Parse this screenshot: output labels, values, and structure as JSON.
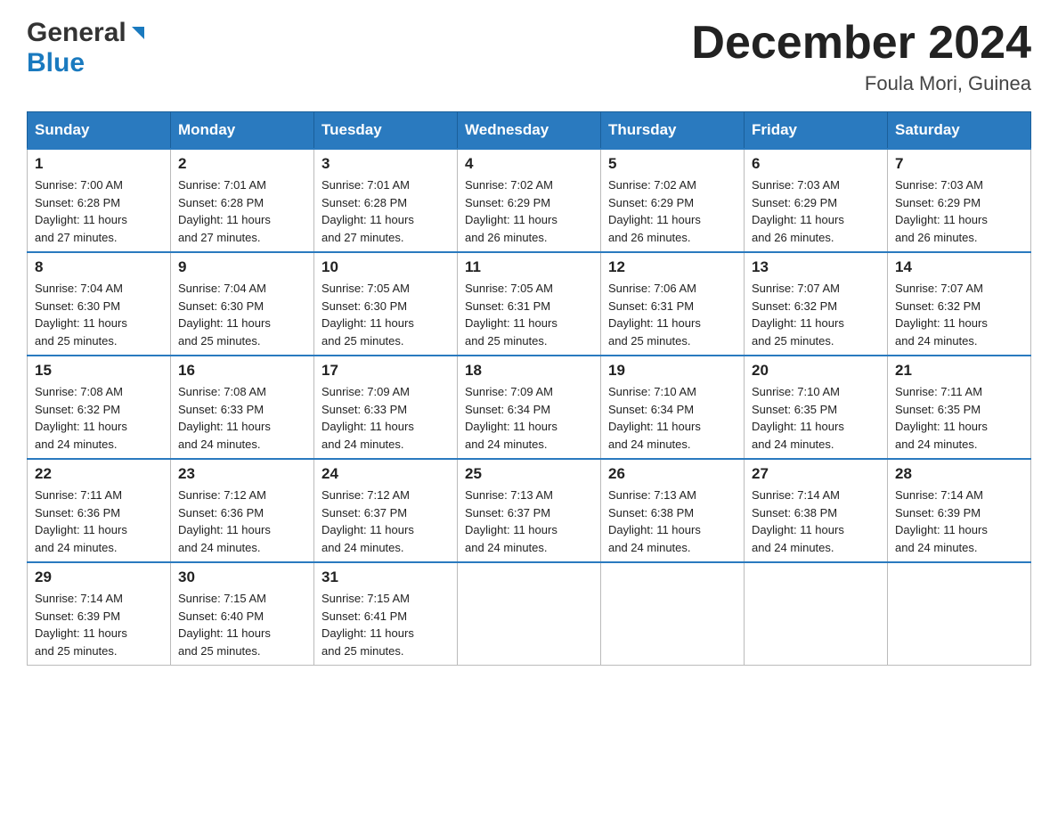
{
  "header": {
    "logo_general": "General",
    "logo_blue": "Blue",
    "month_title": "December 2024",
    "location": "Foula Mori, Guinea"
  },
  "days_of_week": [
    "Sunday",
    "Monday",
    "Tuesday",
    "Wednesday",
    "Thursday",
    "Friday",
    "Saturday"
  ],
  "weeks": [
    [
      {
        "day": "1",
        "sunrise": "7:00 AM",
        "sunset": "6:28 PM",
        "daylight": "11 hours and 27 minutes."
      },
      {
        "day": "2",
        "sunrise": "7:01 AM",
        "sunset": "6:28 PM",
        "daylight": "11 hours and 27 minutes."
      },
      {
        "day": "3",
        "sunrise": "7:01 AM",
        "sunset": "6:28 PM",
        "daylight": "11 hours and 27 minutes."
      },
      {
        "day": "4",
        "sunrise": "7:02 AM",
        "sunset": "6:29 PM",
        "daylight": "11 hours and 26 minutes."
      },
      {
        "day": "5",
        "sunrise": "7:02 AM",
        "sunset": "6:29 PM",
        "daylight": "11 hours and 26 minutes."
      },
      {
        "day": "6",
        "sunrise": "7:03 AM",
        "sunset": "6:29 PM",
        "daylight": "11 hours and 26 minutes."
      },
      {
        "day": "7",
        "sunrise": "7:03 AM",
        "sunset": "6:29 PM",
        "daylight": "11 hours and 26 minutes."
      }
    ],
    [
      {
        "day": "8",
        "sunrise": "7:04 AM",
        "sunset": "6:30 PM",
        "daylight": "11 hours and 25 minutes."
      },
      {
        "day": "9",
        "sunrise": "7:04 AM",
        "sunset": "6:30 PM",
        "daylight": "11 hours and 25 minutes."
      },
      {
        "day": "10",
        "sunrise": "7:05 AM",
        "sunset": "6:30 PM",
        "daylight": "11 hours and 25 minutes."
      },
      {
        "day": "11",
        "sunrise": "7:05 AM",
        "sunset": "6:31 PM",
        "daylight": "11 hours and 25 minutes."
      },
      {
        "day": "12",
        "sunrise": "7:06 AM",
        "sunset": "6:31 PM",
        "daylight": "11 hours and 25 minutes."
      },
      {
        "day": "13",
        "sunrise": "7:07 AM",
        "sunset": "6:32 PM",
        "daylight": "11 hours and 25 minutes."
      },
      {
        "day": "14",
        "sunrise": "7:07 AM",
        "sunset": "6:32 PM",
        "daylight": "11 hours and 24 minutes."
      }
    ],
    [
      {
        "day": "15",
        "sunrise": "7:08 AM",
        "sunset": "6:32 PM",
        "daylight": "11 hours and 24 minutes."
      },
      {
        "day": "16",
        "sunrise": "7:08 AM",
        "sunset": "6:33 PM",
        "daylight": "11 hours and 24 minutes."
      },
      {
        "day": "17",
        "sunrise": "7:09 AM",
        "sunset": "6:33 PM",
        "daylight": "11 hours and 24 minutes."
      },
      {
        "day": "18",
        "sunrise": "7:09 AM",
        "sunset": "6:34 PM",
        "daylight": "11 hours and 24 minutes."
      },
      {
        "day": "19",
        "sunrise": "7:10 AM",
        "sunset": "6:34 PM",
        "daylight": "11 hours and 24 minutes."
      },
      {
        "day": "20",
        "sunrise": "7:10 AM",
        "sunset": "6:35 PM",
        "daylight": "11 hours and 24 minutes."
      },
      {
        "day": "21",
        "sunrise": "7:11 AM",
        "sunset": "6:35 PM",
        "daylight": "11 hours and 24 minutes."
      }
    ],
    [
      {
        "day": "22",
        "sunrise": "7:11 AM",
        "sunset": "6:36 PM",
        "daylight": "11 hours and 24 minutes."
      },
      {
        "day": "23",
        "sunrise": "7:12 AM",
        "sunset": "6:36 PM",
        "daylight": "11 hours and 24 minutes."
      },
      {
        "day": "24",
        "sunrise": "7:12 AM",
        "sunset": "6:37 PM",
        "daylight": "11 hours and 24 minutes."
      },
      {
        "day": "25",
        "sunrise": "7:13 AM",
        "sunset": "6:37 PM",
        "daylight": "11 hours and 24 minutes."
      },
      {
        "day": "26",
        "sunrise": "7:13 AM",
        "sunset": "6:38 PM",
        "daylight": "11 hours and 24 minutes."
      },
      {
        "day": "27",
        "sunrise": "7:14 AM",
        "sunset": "6:38 PM",
        "daylight": "11 hours and 24 minutes."
      },
      {
        "day": "28",
        "sunrise": "7:14 AM",
        "sunset": "6:39 PM",
        "daylight": "11 hours and 24 minutes."
      }
    ],
    [
      {
        "day": "29",
        "sunrise": "7:14 AM",
        "sunset": "6:39 PM",
        "daylight": "11 hours and 25 minutes."
      },
      {
        "day": "30",
        "sunrise": "7:15 AM",
        "sunset": "6:40 PM",
        "daylight": "11 hours and 25 minutes."
      },
      {
        "day": "31",
        "sunrise": "7:15 AM",
        "sunset": "6:41 PM",
        "daylight": "11 hours and 25 minutes."
      },
      null,
      null,
      null,
      null
    ]
  ],
  "labels": {
    "sunrise": "Sunrise:",
    "sunset": "Sunset:",
    "daylight": "Daylight:"
  }
}
